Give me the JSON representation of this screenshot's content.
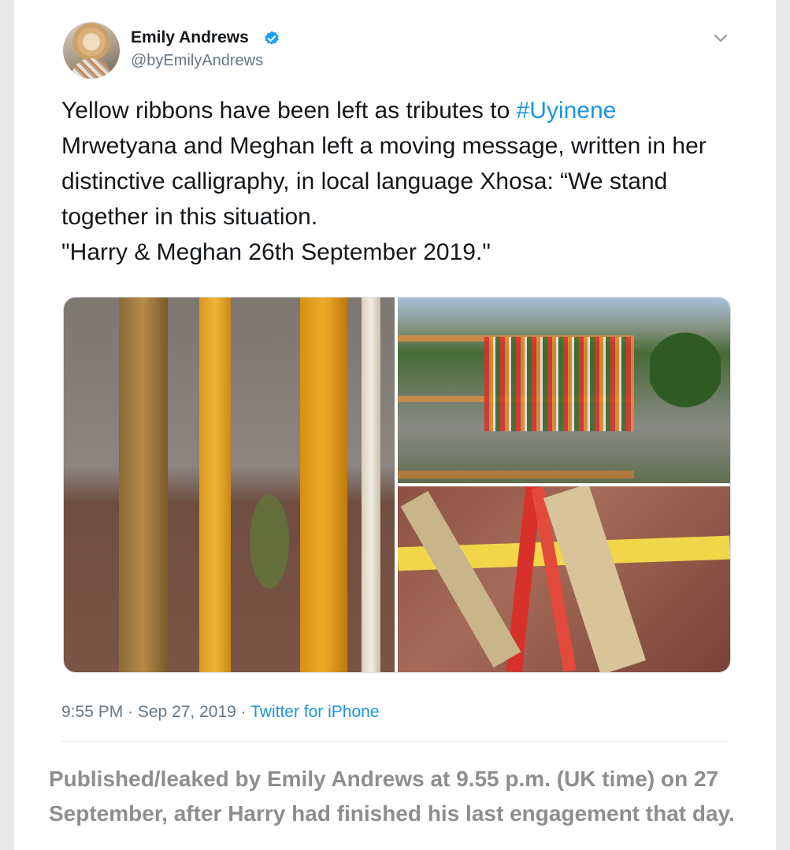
{
  "tweet": {
    "author_name": "Emily Andrews",
    "author_handle": "@byEmilyAndrews",
    "text_before_hashtag": "Yellow ribbons have been left as tributes to ",
    "hashtag": "#Uyinene",
    "text_after_hashtag": "\nMrwetyana and Meghan left a moving message, written in her distinctive calligraphy, in local language Xhosa: “We stand together in this situation.\n\"Harry & Meghan 26th September 2019.\"",
    "time": "9:55 PM · Sep 27, 2019 · ",
    "source": "Twitter for iPhone"
  },
  "colors": {
    "link": "#1b95e0",
    "verified_badge": "#1da1f2",
    "ribbon_yellow": "#e0a526",
    "ribbon_red": "#d8312b"
  },
  "icons": {
    "verified": "verified-badge-icon",
    "menu": "chevron-down-icon"
  },
  "caption": "Published/leaked by Emily Andrews at 9.55 p.m. (UK time) on 27 September, after Harry had finished his last engagement that day."
}
